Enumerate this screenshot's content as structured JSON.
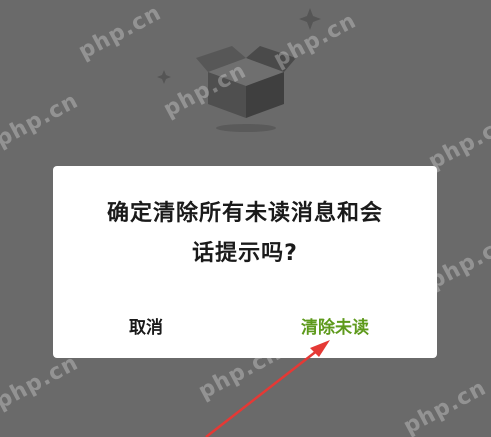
{
  "dialog": {
    "message_line1": "确定清除所有未读消息和会",
    "message_line2": "话提示吗?",
    "cancel_label": "取消",
    "confirm_label": "清除未读"
  },
  "watermark": {
    "text": "php.cn"
  },
  "colors": {
    "backdrop": "#6a6a6a",
    "dialog_bg": "#ffffff",
    "confirm": "#5e9a1c",
    "annotation_arrow": "#e53935"
  },
  "icons": {
    "empty_state": "empty-box-icon"
  }
}
